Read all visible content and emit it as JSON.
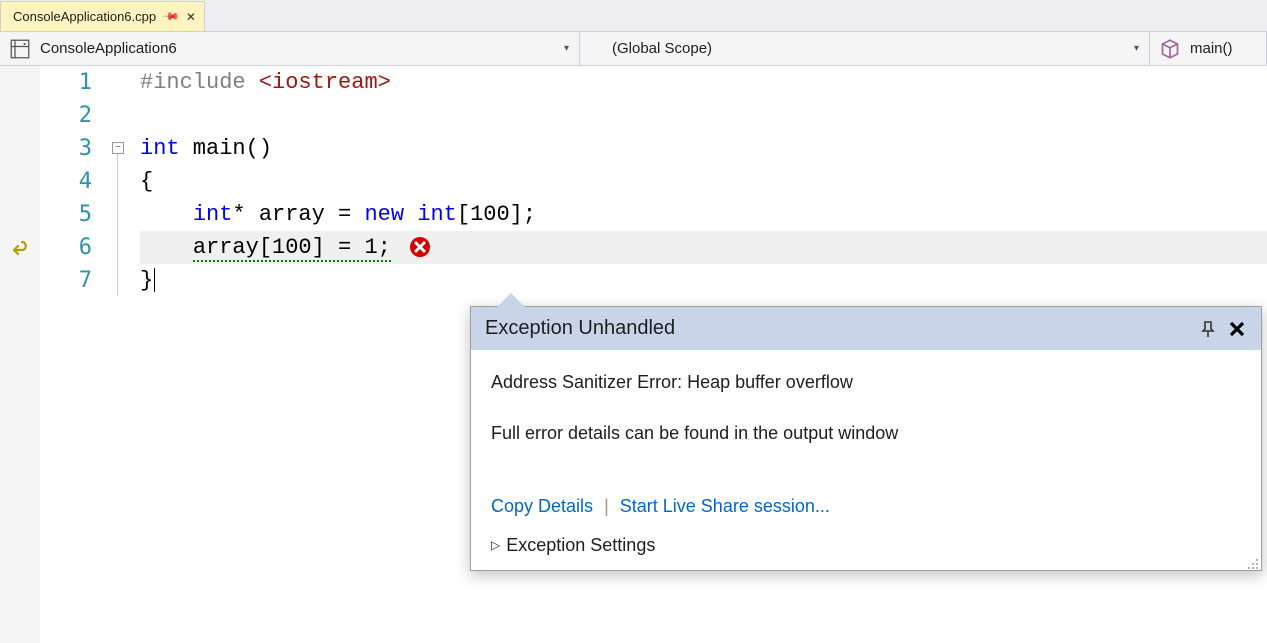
{
  "tab": {
    "filename": "ConsoleApplication6.cpp"
  },
  "nav": {
    "project": "ConsoleApplication6",
    "scope": "(Global Scope)",
    "function": "main()"
  },
  "code": {
    "lines": [
      {
        "n": 1,
        "tokens": [
          [
            "pp",
            "#include "
          ],
          [
            "str",
            "<iostream>"
          ]
        ]
      },
      {
        "n": 2,
        "tokens": []
      },
      {
        "n": 3,
        "tokens": [
          [
            "kw",
            "int"
          ],
          [
            "tx",
            " main()"
          ]
        ]
      },
      {
        "n": 4,
        "tokens": [
          [
            "tx",
            "{"
          ]
        ]
      },
      {
        "n": 5,
        "tokens": [
          [
            "tx",
            "    "
          ],
          [
            "kw",
            "int"
          ],
          [
            "tx",
            "* array = "
          ],
          [
            "kw",
            "new"
          ],
          [
            "tx",
            " "
          ],
          [
            "kw",
            "int"
          ],
          [
            "tx",
            "[100];"
          ]
        ]
      },
      {
        "n": 6,
        "tokens": [
          [
            "tx",
            "    "
          ],
          [
            "sq",
            "array[100] = 1;"
          ]
        ],
        "error": true,
        "current": true
      },
      {
        "n": 7,
        "tokens": [
          [
            "tx",
            "}"
          ]
        ],
        "caret": true
      }
    ],
    "break_line": 6
  },
  "popup": {
    "title": "Exception Unhandled",
    "message_main": "Address Sanitizer Error: Heap buffer overflow",
    "message_sub": "Full error details can be found in the output window",
    "link_copy": "Copy Details",
    "link_liveshare": "Start Live Share session...",
    "settings_label": "Exception Settings"
  }
}
